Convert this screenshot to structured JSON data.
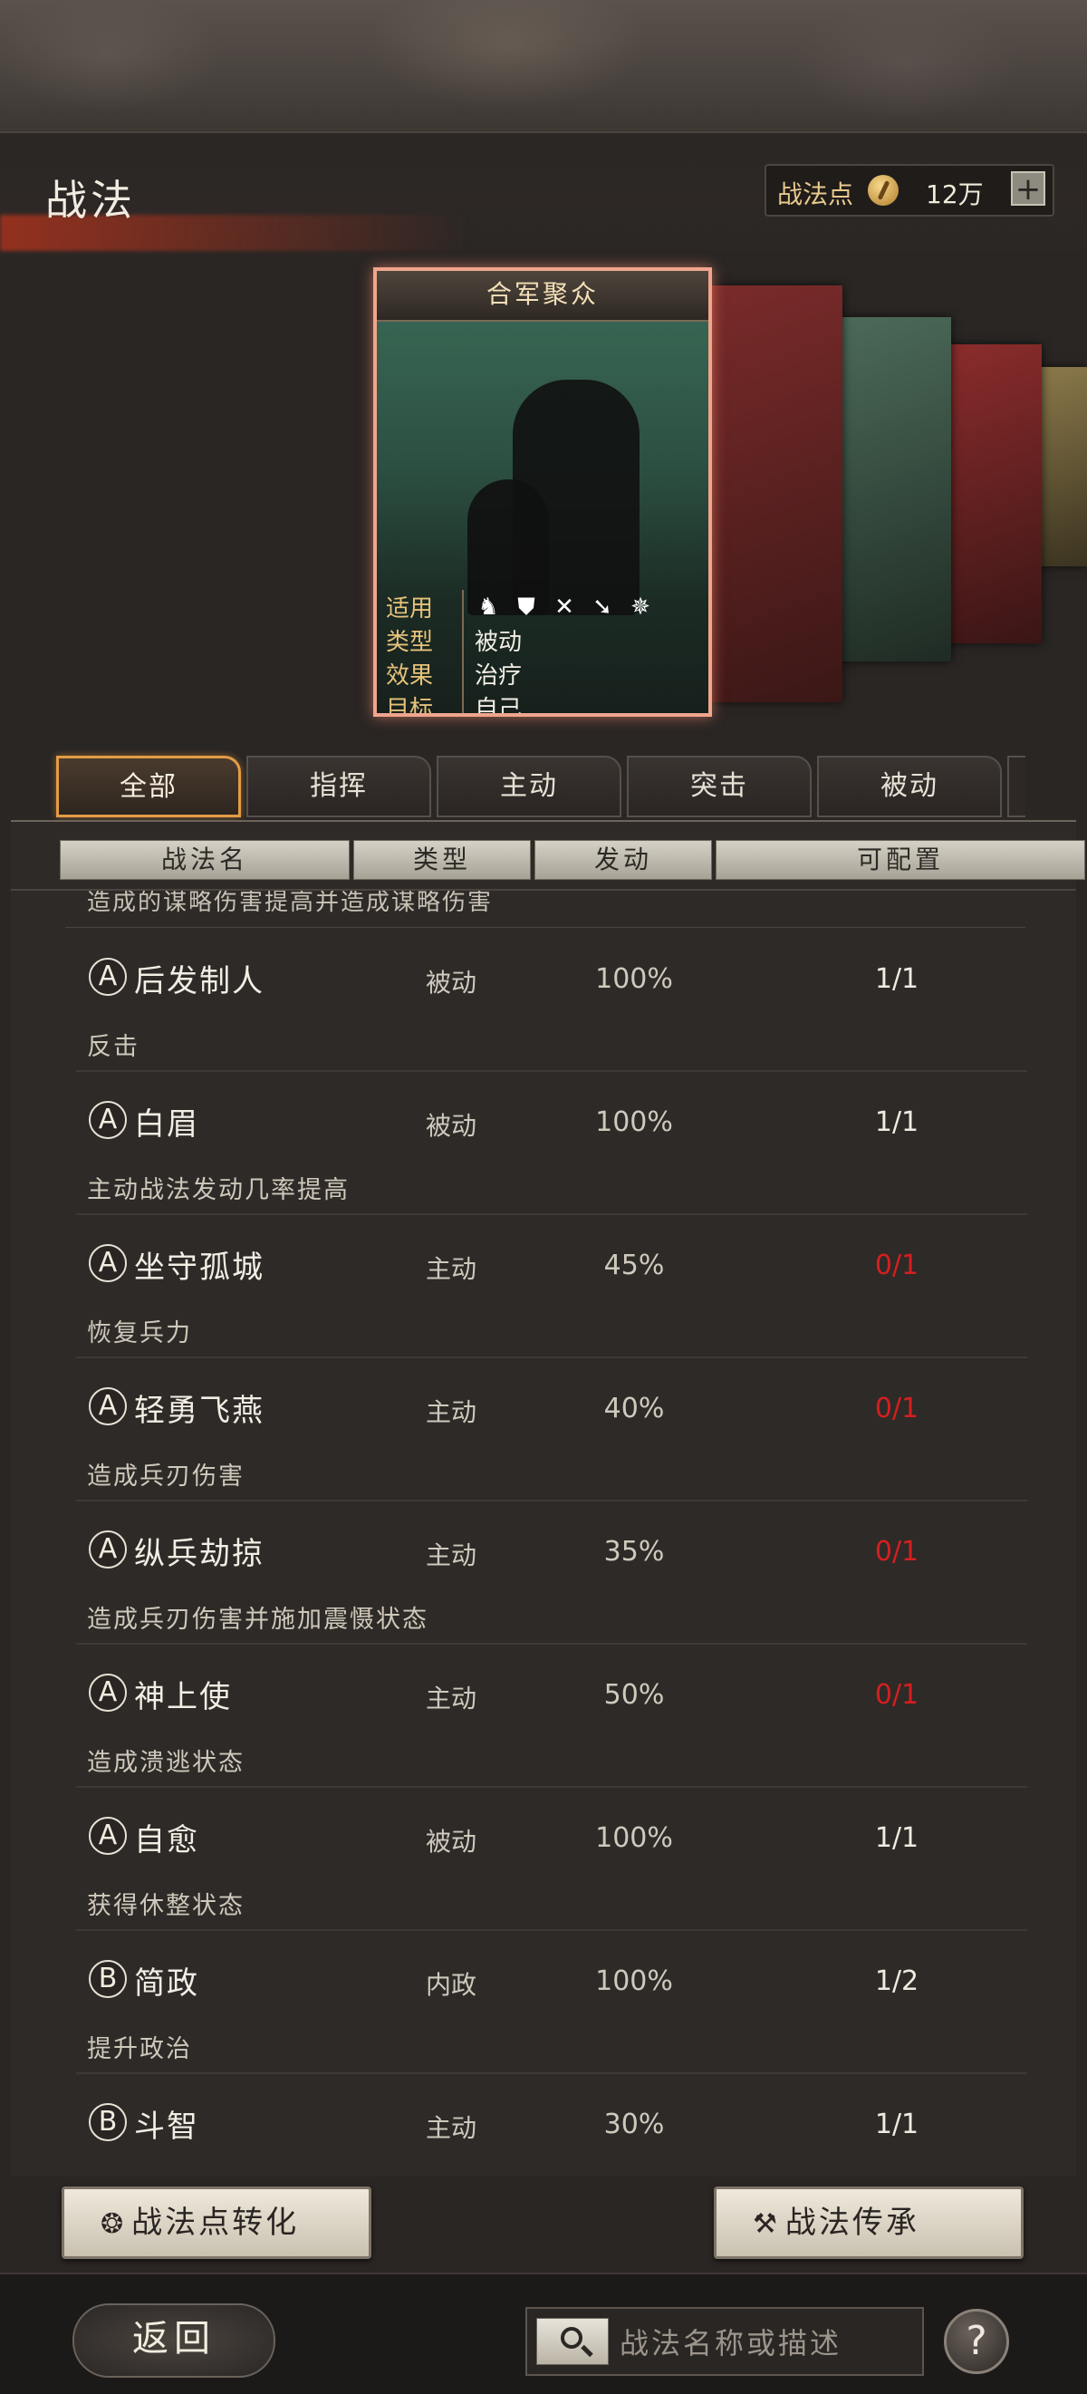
{
  "header": {
    "title": "战法",
    "points_label": "战法点",
    "points_value": "12万",
    "plus_label": "+"
  },
  "card": {
    "title": "合军聚众",
    "info": [
      {
        "key": "适用",
        "value": ""
      },
      {
        "key": "类型",
        "value": "被动"
      },
      {
        "key": "效果",
        "value": "治疗"
      },
      {
        "key": "目标",
        "value": "自己"
      }
    ],
    "unit_icons": [
      "cavalry-icon",
      "shield-icon",
      "archer-icon",
      "spear-icon",
      "wheel-icon"
    ],
    "unit_glyphs": [
      "♞",
      "⛊",
      "✕",
      "➘",
      "✵"
    ]
  },
  "tabs": [
    "全部",
    "指挥",
    "主动",
    "突击",
    "被动"
  ],
  "table": {
    "headers": [
      "战法名",
      "类型",
      "发动",
      "可配置"
    ],
    "cut_text": "造成的谋略伤害提高并造成谋略伤害",
    "rows": [
      {
        "grade": "A",
        "name": "后发制人",
        "type": "被动",
        "rate": "100%",
        "avail": "1/1",
        "red": false,
        "desc": "反击"
      },
      {
        "grade": "A",
        "name": "白眉",
        "type": "被动",
        "rate": "100%",
        "avail": "1/1",
        "red": false,
        "desc": "主动战法发动几率提高"
      },
      {
        "grade": "A",
        "name": "坐守孤城",
        "type": "主动",
        "rate": "45%",
        "avail": "0/1",
        "red": true,
        "desc": "恢复兵力"
      },
      {
        "grade": "A",
        "name": "轻勇飞燕",
        "type": "主动",
        "rate": "40%",
        "avail": "0/1",
        "red": true,
        "desc": "造成兵刃伤害"
      },
      {
        "grade": "A",
        "name": "纵兵劫掠",
        "type": "主动",
        "rate": "35%",
        "avail": "0/1",
        "red": true,
        "desc": "造成兵刃伤害并施加震慑状态"
      },
      {
        "grade": "A",
        "name": "神上使",
        "type": "主动",
        "rate": "50%",
        "avail": "0/1",
        "red": true,
        "desc": "造成溃逃状态"
      },
      {
        "grade": "A",
        "name": "自愈",
        "type": "被动",
        "rate": "100%",
        "avail": "1/1",
        "red": false,
        "desc": "获得休整状态"
      },
      {
        "grade": "B",
        "name": "简政",
        "type": "内政",
        "rate": "100%",
        "avail": "1/2",
        "red": false,
        "desc": "提升政治"
      },
      {
        "grade": "B",
        "name": "斗智",
        "type": "主动",
        "rate": "30%",
        "avail": "1/1",
        "red": false,
        "desc": ""
      }
    ]
  },
  "actions": {
    "convert_label": "战法点转化",
    "inherit_label": "战法传承"
  },
  "footer": {
    "back_label": "返回",
    "search_placeholder": "战法名称或描述",
    "help_label": "?"
  },
  "colors": {
    "accent": "#e49c45",
    "unavailable": "#d51f1f",
    "card_border": "#f0a58d"
  }
}
